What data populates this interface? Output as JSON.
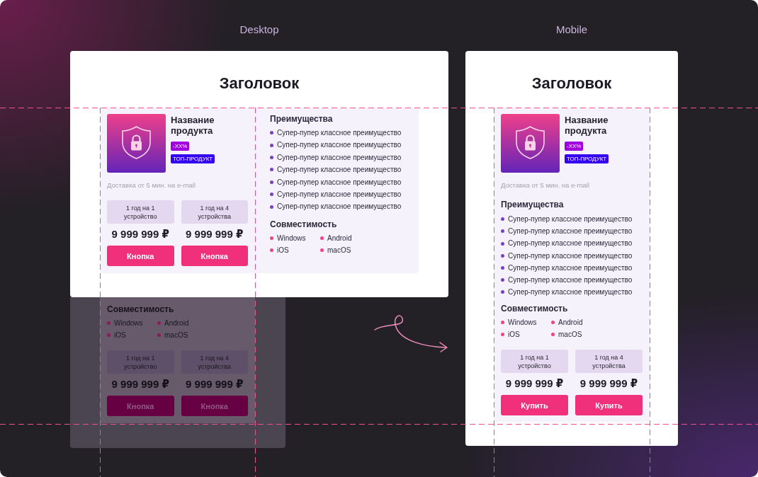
{
  "views": [
    {
      "kind": "desktop",
      "label": "Desktop",
      "title": "Заголовок",
      "product": {
        "name": "Название продукта",
        "badges": [
          {
            "text": "-XX%",
            "color": "#a000dd"
          },
          {
            "text": "ТОП-ПРОДУКТ",
            "color": "#3300f2"
          }
        ],
        "delivery": "Доставка от 5 мин. на e-mail"
      },
      "plans": [
        {
          "option": "1 год на 1 устройство",
          "price": "9 999 999 ₽",
          "button": "Кнопка"
        },
        {
          "option": "1 год на 4 устройства",
          "price": "9 999 999 ₽",
          "button": "Кнопка"
        }
      ],
      "advantages": {
        "heading": "Преимущества",
        "items": [
          "Супер-пупер классное преимущество",
          "Супер-пупер классное преимущество",
          "Супер-пупер классное преимущество",
          "Супер-пупер классное преимущество",
          "Супер-пупер классное преимущество",
          "Супер-пупер классное преимущество",
          "Супер-пупер классное преимущество"
        ]
      },
      "compatibility": {
        "heading": "Совместимость",
        "platforms": [
          "Windows",
          "Android",
          "iOS",
          "macOS"
        ]
      },
      "overflow": {
        "compatibility": {
          "heading": "Совместимость",
          "platforms": [
            "Windows",
            "Android",
            "iOS",
            "macOS"
          ]
        },
        "plans": [
          {
            "option": "1 год на 1 устройство",
            "price": "9 999 999 ₽",
            "button": "Кнопка"
          },
          {
            "option": "1 год на 4 устройства",
            "price": "9 999 999 ₽",
            "button": "Кнопка"
          }
        ]
      }
    },
    {
      "kind": "mobile",
      "label": "Mobile",
      "title": "Заголовок",
      "product": {
        "name": "Название продукта",
        "badges": [
          {
            "text": "-XX%",
            "color": "#a000dd"
          },
          {
            "text": "ТОП-ПРОДУКТ",
            "color": "#3300f2"
          }
        ],
        "delivery": "Доставка от 5 мин. на e-mail"
      },
      "advantages": {
        "heading": "Преимущества",
        "items": [
          "Супер-пупер классное преимущество",
          "Супер-пупер классное преимущество",
          "Супер-пупер классное преимущество",
          "Супер-пупер классное преимущество",
          "Супер-пупер классное преимущество",
          "Супер-пупер классное преимущество",
          "Супер-пупер классное преимущество"
        ]
      },
      "compatibility": {
        "heading": "Совместимость",
        "platforms": [
          "Windows",
          "Android",
          "iOS",
          "macOS"
        ]
      },
      "plans": [
        {
          "option": "1 год на 1 устройство",
          "price": "9 999 999 ₽",
          "button": "Купить"
        },
        {
          "option": "1 год на 4 устройства",
          "price": "9 999 999 ₽",
          "button": "Купить"
        }
      ]
    }
  ]
}
